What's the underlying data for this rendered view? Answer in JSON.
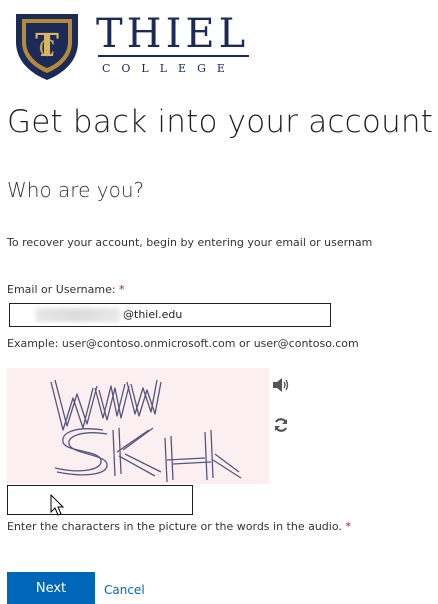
{
  "logo": {
    "name": "THIEL",
    "sub": "COLLEGE",
    "shield_colors": {
      "outer": "#1b2a57",
      "ring": "#b48a3a",
      "inner": "#1b2a57"
    }
  },
  "page": {
    "title": "Get back into your account",
    "subtitle": "Who are you?",
    "intro": "To recover your account, begin by entering your email or usernam"
  },
  "form": {
    "email_label": "Email or Username:",
    "required_mark": "*",
    "email_value_visible": "@thiel.edu",
    "example": "Example: user@contoso.onmicrosoft.com or user@contoso.com",
    "captcha_hint": "Enter the characters in the picture or the words in the audio.",
    "captcha_value": ""
  },
  "icons": {
    "audio": "speaker-icon",
    "refresh": "refresh-icon",
    "cursor": "mouse-cursor-icon"
  },
  "actions": {
    "next_label": "Next",
    "cancel_label": "Cancel"
  },
  "colors": {
    "primary": "#0067b8",
    "required": "#c50f1f",
    "captcha_bg": "#fbeff2",
    "brand_navy": "#1b2a57"
  }
}
